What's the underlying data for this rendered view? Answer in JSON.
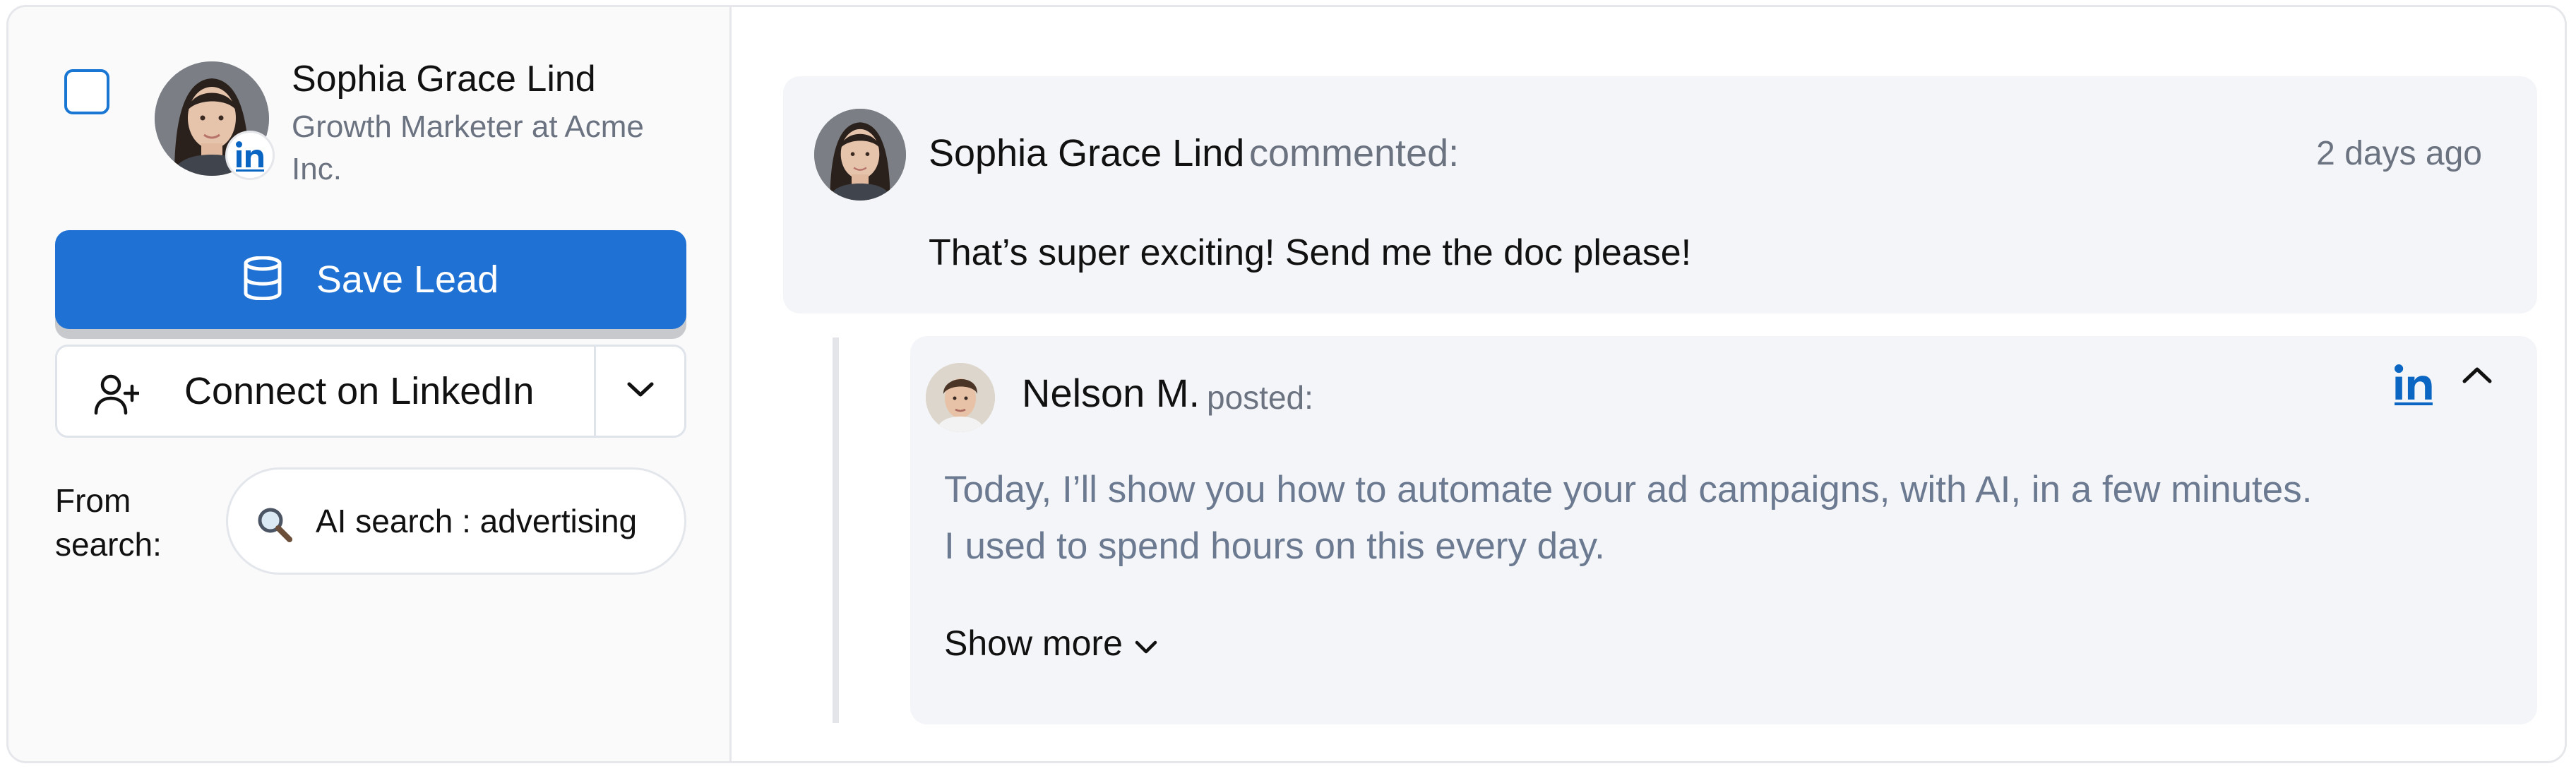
{
  "lead": {
    "name": "Sophia Grace Lind",
    "title": "Growth Marketer at Acme Inc.",
    "selected": false
  },
  "actions": {
    "save_label": "Save Lead",
    "connect_label": "Connect on LinkedIn"
  },
  "source": {
    "label": "From search:",
    "search_text": "AI search : advertising"
  },
  "comment": {
    "author": "Sophia Grace Lind",
    "verb": "commented:",
    "time": "2 days ago",
    "text": "That’s super exciting! Send me the doc please!"
  },
  "post": {
    "author": "Nelson M.",
    "verb": "posted:",
    "line1": "Today, I’ll show you how to automate your ad campaigns, with AI, in a few minutes.",
    "line2": "I used to spend hours on this every day.",
    "show_more": "Show more"
  },
  "icons": {
    "database": "database-icon",
    "add_user": "user-plus-icon",
    "chevron_down": "chevron-down-icon",
    "chevron_up": "chevron-up-icon",
    "linkedin": "linkedin-icon",
    "search": "magnifier-icon"
  },
  "colors": {
    "accent": "#1f72d4",
    "linkedin": "#0a66c2",
    "muted_text": "#6b7280",
    "post_text": "#6b7a90"
  }
}
